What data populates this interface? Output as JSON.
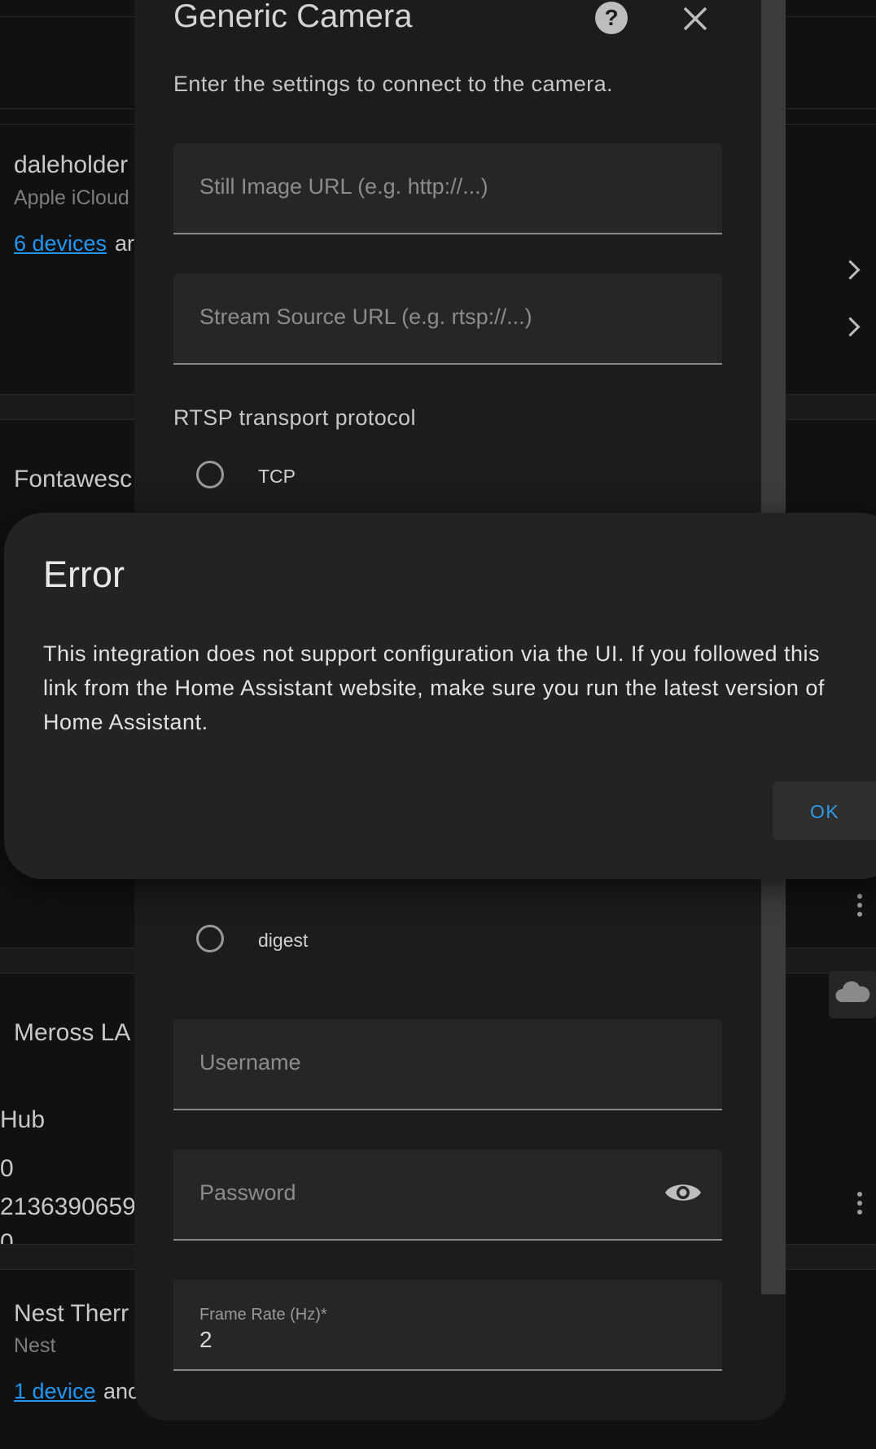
{
  "background": {
    "items": [
      {
        "title": "daleholder",
        "subtitle": "Apple iCloud",
        "link": "6 devices",
        "link_rest": "ar"
      },
      {
        "title": "Fontawesc"
      },
      {
        "title": "Meross LA",
        "lines": [
          "Hub",
          "0",
          "2136390659",
          "0"
        ]
      },
      {
        "title": "Nest Therr",
        "subtitle": "Nest",
        "link": "1 device",
        "link_rest": "anc"
      }
    ]
  },
  "camera_dialog": {
    "title": "Generic Camera",
    "description": "Enter the settings to connect to the camera.",
    "still_image_placeholder": "Still Image URL (e.g. http://...)",
    "stream_source_placeholder": "Stream Source URL (e.g. rtsp://...)",
    "rtsp_label": "RTSP transport protocol",
    "rtsp_options": [
      "TCP"
    ],
    "auth_options": [
      "digest"
    ],
    "username_placeholder": "Username",
    "password_placeholder": "Password",
    "frame_rate_label": "Frame Rate (Hz)*",
    "frame_rate_value": "2"
  },
  "error_dialog": {
    "title": "Error",
    "message": "This integration does not support configuration via the UI. If you followed this link from the Home Assistant website, make sure you run the latest version of Home Assistant.",
    "ok_label": "OK"
  }
}
